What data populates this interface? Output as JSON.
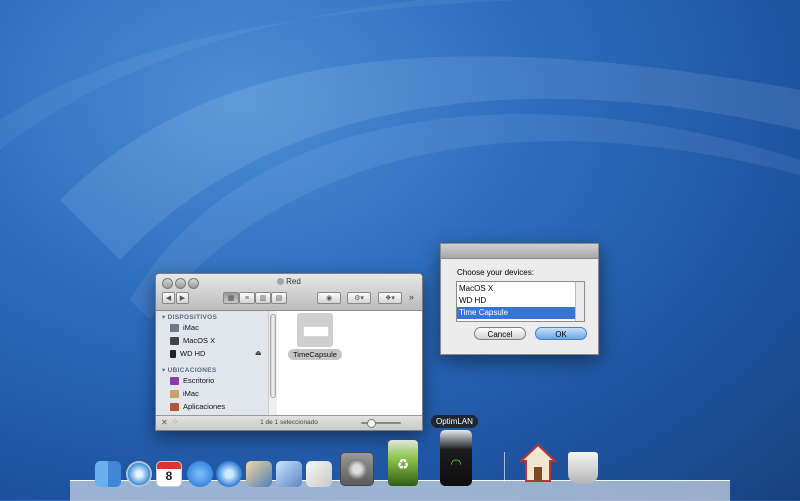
{
  "finder": {
    "title": "Red",
    "sidebar": {
      "devices_header": "DISPOSITIVOS",
      "devices": [
        "iMac",
        "MacOS X",
        "WD HD"
      ],
      "places_header": "UBICACIONES",
      "places": [
        "Escritorio",
        "iMac",
        "Aplicaciones"
      ]
    },
    "file_name": "TimeCapsule",
    "status": "1 de 1 seleccionado"
  },
  "dialog": {
    "prompt": "Choose your devices:",
    "items": [
      "MacOS X",
      "WD HD",
      "Time Capsule"
    ],
    "selected_index": 2,
    "cancel_label": "Cancel",
    "ok_label": "OK"
  },
  "dock": {
    "tooltip": "OptimLAN",
    "calendar_day": "8",
    "icons": [
      "finder-icon",
      "safari-icon",
      "ical-icon",
      "app-store-icon",
      "itunes-icon",
      "iphoto-icon",
      "xcode-icon",
      "script-editor-icon",
      "system-preferences-icon",
      "recycle-bin-icon",
      "optimlan-icon",
      "home-icon",
      "trash-icon"
    ]
  },
  "colors": {
    "selection": "#3874d8",
    "desktop": "#2f6fc0"
  }
}
